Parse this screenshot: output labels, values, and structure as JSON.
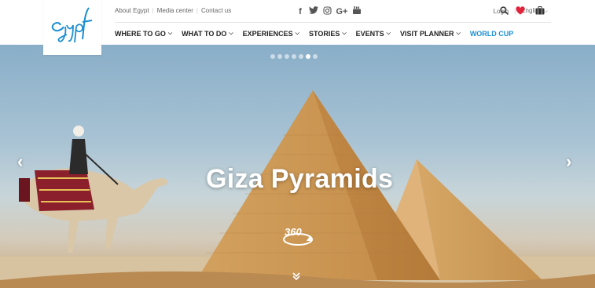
{
  "brand": {
    "logo_text": "Egypt"
  },
  "utility_links": [
    "About Egypt",
    "Media center",
    "Contact us"
  ],
  "social_icons": [
    "facebook-icon",
    "twitter-icon",
    "instagram-icon",
    "google-plus-icon",
    "youtube-icon"
  ],
  "social_glyphs": [
    "f",
    "t",
    "◎",
    "G+",
    "▶"
  ],
  "account": {
    "login": "Login",
    "language": "English"
  },
  "header_icons": [
    "search-icon",
    "heart-icon",
    "suitcase-icon"
  ],
  "nav": [
    {
      "label": "WHERE TO GO",
      "has_dropdown": true
    },
    {
      "label": "WHAT TO DO",
      "has_dropdown": true
    },
    {
      "label": "EXPERIENCES",
      "has_dropdown": true
    },
    {
      "label": "STORIES",
      "has_dropdown": true
    },
    {
      "label": "EVENTS",
      "has_dropdown": true
    },
    {
      "label": "VISIT PLANNER",
      "has_dropdown": true
    },
    {
      "label": "WORLD CUP",
      "has_dropdown": false,
      "accent": true
    }
  ],
  "hero": {
    "title": "Giza Pyramids",
    "badge": "360",
    "slides_total": 7,
    "active_slide": 6
  },
  "colors": {
    "accent": "#1b8fd2",
    "heart": "#e0243b",
    "text": "#222222"
  }
}
